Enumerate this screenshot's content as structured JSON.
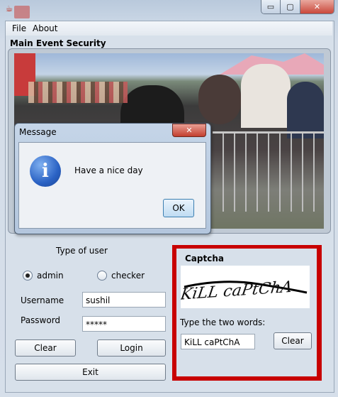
{
  "menu": {
    "file": "File",
    "about": "About"
  },
  "section_title": "Main Event Security",
  "dialog": {
    "title": "Message",
    "close": "✕",
    "message": "Have a nice day",
    "ok": "OK"
  },
  "form": {
    "user_type_label": "Type of user",
    "radio_admin": "admin",
    "radio_checker": "checker",
    "selected_user_type": "admin",
    "username_label": "Username",
    "username_value": "sushil",
    "password_label": "Password",
    "password_value": "*****",
    "clear_label": "Clear",
    "login_label": "Login",
    "exit_label": "Exit"
  },
  "captcha": {
    "title": "Captcha",
    "image_text": "KiLL caPtChA",
    "prompt": "Type the two words:",
    "answer_value": "KiLL caPtChA",
    "clear_label": "Clear",
    "border_color": "#c80000"
  },
  "window_controls": {
    "minimize": "▭",
    "maximize": "▢",
    "close": "✕"
  },
  "icons": {
    "app": "java-icon",
    "dialog": "info-icon"
  },
  "colors": {
    "accent_red": "#c80000",
    "ok_border": "#3c7fb1"
  }
}
